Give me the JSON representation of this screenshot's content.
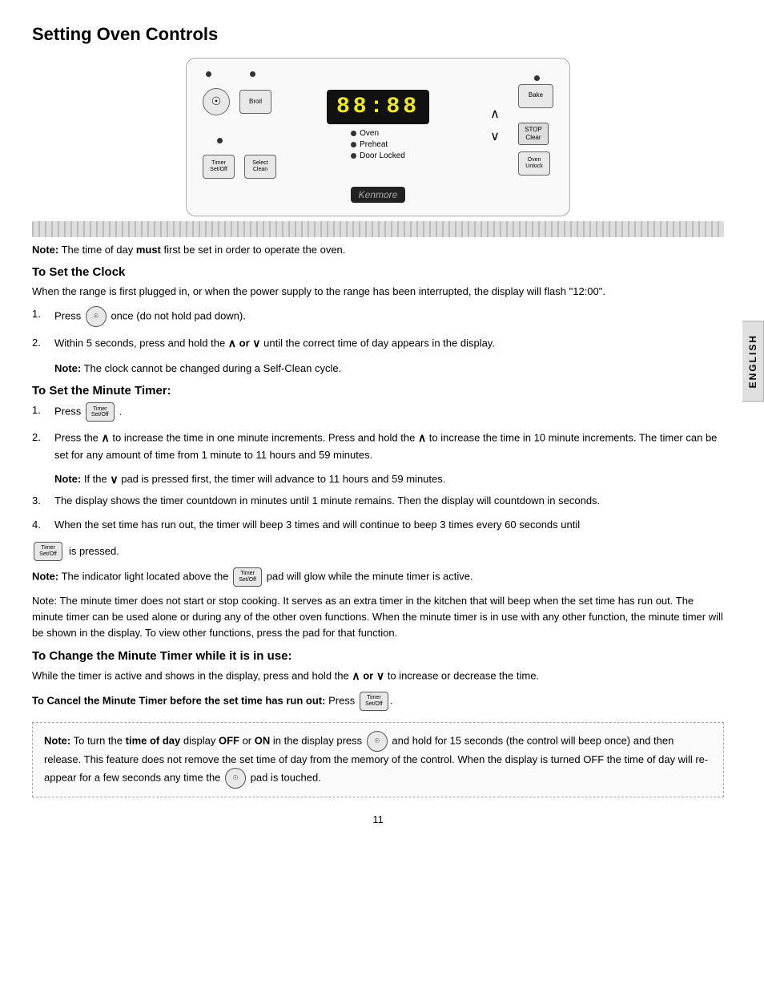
{
  "page": {
    "title": "Setting Oven Controls",
    "page_number": "11",
    "english_tab": "ENGLISH"
  },
  "diagram": {
    "display_text": "88:88",
    "kenmore_brand": "Kenmore",
    "buttons": {
      "timer": "Timer\nSet/Off",
      "broil": "Broil",
      "select_clean": "Select\nClean",
      "bake": "Bake",
      "stop_clear": "STOP\nClear",
      "oven_unlock": "Oven\nUnlock"
    },
    "status_labels": [
      "Oven",
      "Preheat",
      "Door Locked"
    ]
  },
  "note_time": "Note: The time of day must first be set in order to operate the oven.",
  "clock_section": {
    "title": "To Set the Clock",
    "intro": "When the range is first plugged in, or when the power supply to the range has been interrupted, the display will flash \"12:00\".",
    "steps": [
      {
        "num": "1.",
        "text": "Press",
        "button": "clock",
        "after": "once (do not hold pad down)."
      },
      {
        "num": "2.",
        "text": "Within 5 seconds, press and hold the",
        "arrows": "∧ or ∨",
        "after": "until the correct time of day appears in the display."
      }
    ],
    "clock_note": "Note: The clock cannot be changed during a Self-Clean cycle."
  },
  "timer_section": {
    "title": "To Set the Minute Timer:",
    "steps": [
      {
        "num": "1.",
        "text": "Press",
        "button": "timer",
        "after": "."
      },
      {
        "num": "2.",
        "text": "Press the ∧ to increase the time in one minute increments. Press and hold the ∧ to increase the time in 10 minute increments. The timer can be set for any amount of time from 1 minute to 11 hours and 59 minutes."
      }
    ],
    "note2": "Note: If the ∨ pad is pressed first, the timer will advance to 11 hours and 59 minutes.",
    "step3": "The display shows the timer countdown in minutes until 1 minute remains. Then the display will countdown in seconds.",
    "step4": "When the set time has run out, the timer will beep 3 times and will continue to beep 3 times every 60 seconds until",
    "step4_end": "is pressed.",
    "note3": "Note: The indicator light located above the",
    "note3_end": "pad will glow while the minute timer is active.",
    "note4": "Note: The minute timer does not start or stop cooking. It serves as an extra timer in the kitchen that will beep when the set time has run out. The minute timer can be used alone or during any of the other oven functions. When the minute timer is in use with any other function, the minute timer will be shown in the display. To view other functions, press the pad for that function.",
    "change_title": "To Change the Minute Timer while it is in use:",
    "change_text": "While the timer is active and shows in the display, press and hold the ∧ or ∨ to increase or decrease the time.",
    "cancel_title": "To Cancel the Minute Timer before the set time has run out:",
    "cancel_press": "Press"
  },
  "bottom_note": {
    "text1": "Note: To turn the",
    "bold1": "time of day",
    "text2": "display",
    "bold2": "OFF",
    "text3": "or",
    "bold3": "ON",
    "text4": "in the display press",
    "text5": "and hold for 15 seconds (the control will beep once) and then release. This feature does not remove the set time of day from the memory of the control. When the display is turned OFF the time of day will re-appear for a few seconds any time the",
    "text6": "pad is touched."
  }
}
